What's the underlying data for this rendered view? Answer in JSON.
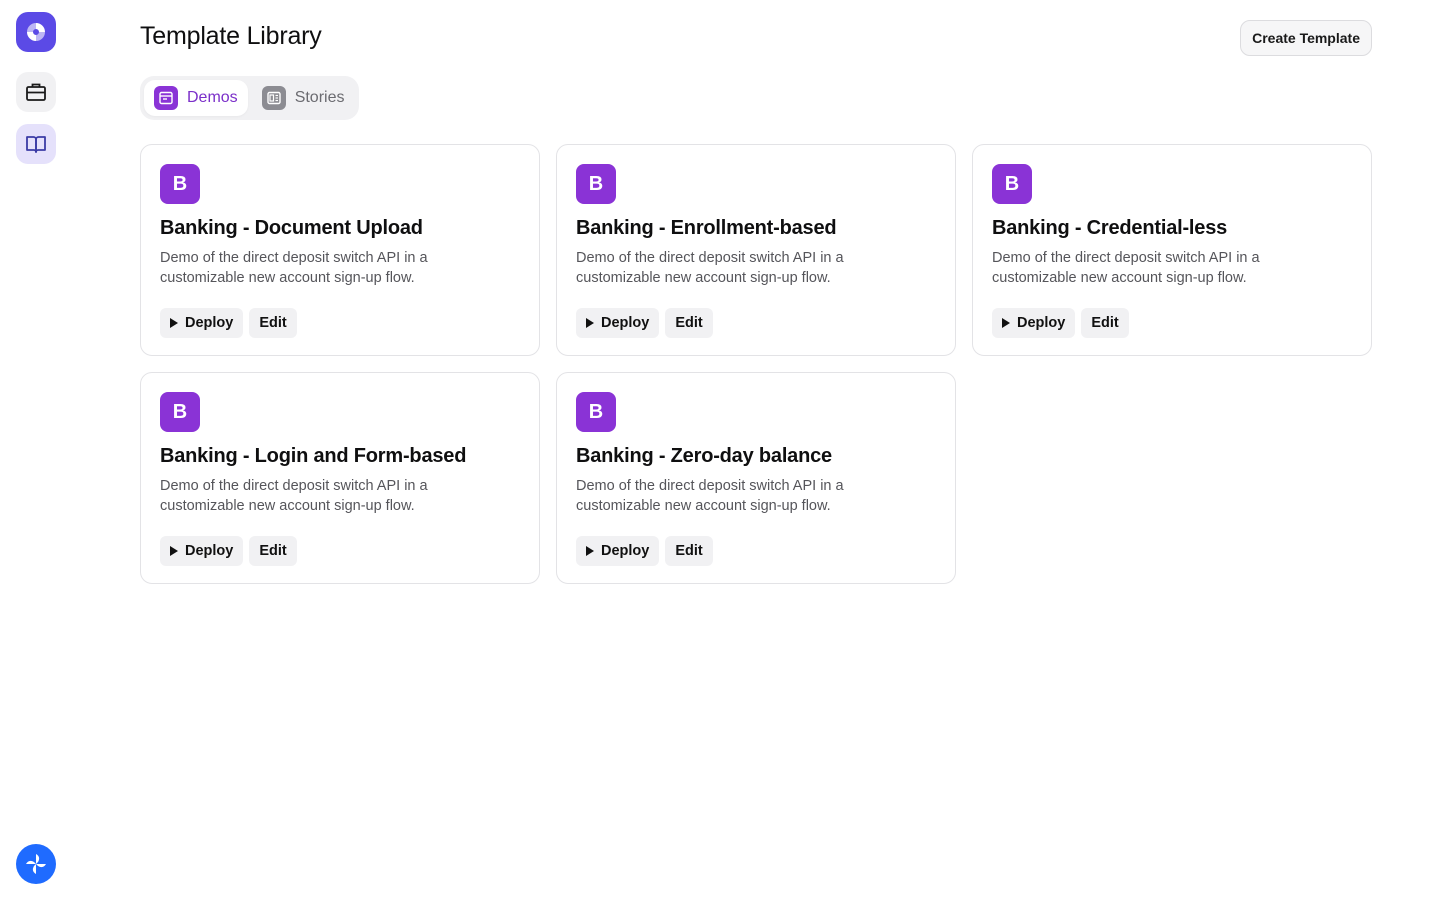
{
  "header": {
    "title": "Template Library",
    "create_button": "Create Template"
  },
  "tabs": [
    {
      "label": "Demos",
      "active": true,
      "icon": "window-icon"
    },
    {
      "label": "Stories",
      "active": false,
      "icon": "layout-icon"
    }
  ],
  "sidebar": {
    "items": [
      {
        "name": "briefcase-icon",
        "active": false
      },
      {
        "name": "book-icon",
        "active": true
      }
    ]
  },
  "templates": [
    {
      "badge": "B",
      "title": "Banking - Document Upload",
      "description": "Demo of the direct deposit switch API in a customizable new account sign-up flow.",
      "deploy_label": "Deploy",
      "edit_label": "Edit"
    },
    {
      "badge": "B",
      "title": "Banking - Enrollment-based",
      "description": "Demo of the direct deposit switch API in a customizable new account sign-up flow.",
      "deploy_label": "Deploy",
      "edit_label": "Edit"
    },
    {
      "badge": "B",
      "title": "Banking - Credential-less",
      "description": "Demo of the direct deposit switch API in a customizable new account sign-up flow.",
      "deploy_label": "Deploy",
      "edit_label": "Edit"
    },
    {
      "badge": "B",
      "title": "Banking - Login and Form-based",
      "description": "Demo of the direct deposit switch API in a customizable new account sign-up flow.",
      "deploy_label": "Deploy",
      "edit_label": "Edit"
    },
    {
      "badge": "B",
      "title": "Banking - Zero-day balance",
      "description": "Demo of the direct deposit switch API in a customizable new account sign-up flow.",
      "deploy_label": "Deploy",
      "edit_label": "Edit"
    }
  ],
  "colors": {
    "accent": "#8a33d6",
    "brand": "#5b4ae6",
    "bottom_logo": "#1f6bff"
  }
}
